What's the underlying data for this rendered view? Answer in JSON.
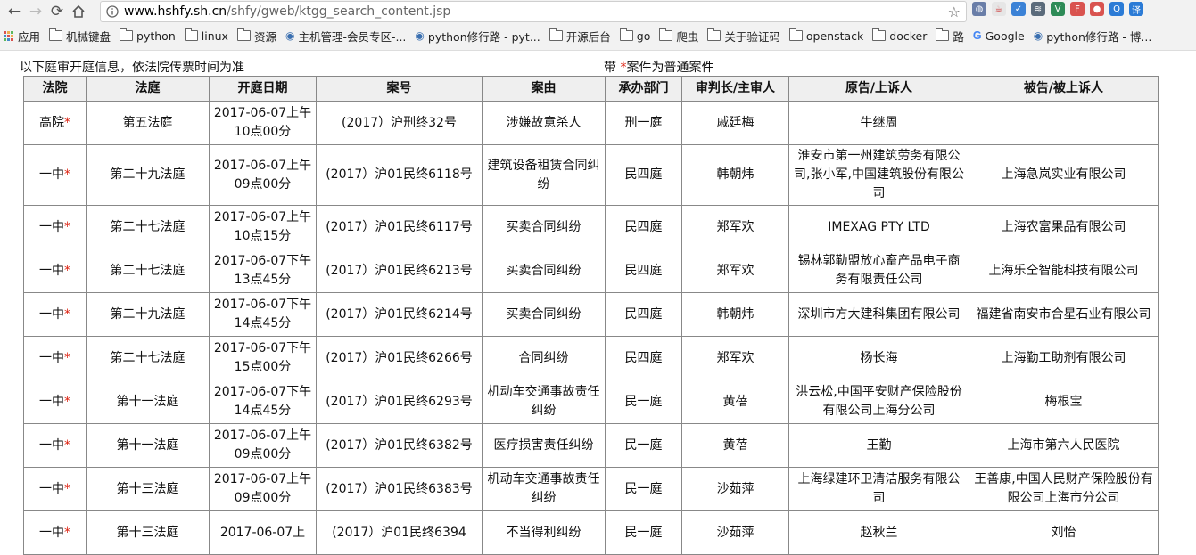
{
  "browser": {
    "url_host": "www.hshfy.sh.cn",
    "url_path": "/shfy/gweb/ktgg_search_content.jsp",
    "extensions": [
      {
        "icon": "extension-icon-1",
        "color": "#6a7ea8",
        "glyph": "◍"
      },
      {
        "icon": "java-icon",
        "color": "#e6e6e6",
        "glyph": "☕"
      },
      {
        "icon": "pocket-icon",
        "color": "#3b82d6",
        "glyph": "✓"
      },
      {
        "icon": "layers-icon",
        "color": "#5b6b7b",
        "glyph": "≋"
      },
      {
        "icon": "vim-icon",
        "color": "#2e8b57",
        "glyph": "V"
      },
      {
        "icon": "framework-icon",
        "color": "#d9534f",
        "glyph": "F"
      },
      {
        "icon": "record-icon",
        "color": "#d9534f",
        "glyph": "●"
      },
      {
        "icon": "search-ext-icon",
        "color": "#2b7bd6",
        "glyph": "Q"
      },
      {
        "icon": "translate-icon",
        "color": "#2b7bd6",
        "glyph": "译"
      }
    ],
    "bookmarks": [
      {
        "label": "应用",
        "icon": "apps-grid-icon"
      },
      {
        "label": "机械键盘",
        "icon": "folder-icon"
      },
      {
        "label": "python",
        "icon": "folder-icon"
      },
      {
        "label": "linux",
        "icon": "folder-icon"
      },
      {
        "label": "资源",
        "icon": "folder-icon"
      },
      {
        "label": "主机管理-会员专区-...",
        "icon": "site-icon"
      },
      {
        "label": "python修行路 - pyt...",
        "icon": "site-icon"
      },
      {
        "label": "开源后台",
        "icon": "folder-icon"
      },
      {
        "label": "go",
        "icon": "folder-icon"
      },
      {
        "label": "爬虫",
        "icon": "folder-icon"
      },
      {
        "label": "关于验证码",
        "icon": "folder-icon"
      },
      {
        "label": "openstack",
        "icon": "folder-icon"
      },
      {
        "label": "docker",
        "icon": "folder-icon"
      },
      {
        "label": "路",
        "icon": "folder-icon"
      },
      {
        "label": "Google",
        "icon": "google-icon"
      },
      {
        "label": "python修行路 - 博...",
        "icon": "site-icon"
      }
    ]
  },
  "page": {
    "notice_left": "以下庭审开庭信息，依法院传票时间为准",
    "notice_right_prefix": "带 ",
    "notice_right_star": "*",
    "notice_right_suffix": "案件为普通案件",
    "headers": [
      "法院",
      "法庭",
      "开庭日期",
      "案号",
      "案由",
      "承办部门",
      "审判长/主审人",
      "原告/上诉人",
      "被告/被上诉人"
    ],
    "rows": [
      {
        "court": "高院",
        "room": "第五法庭",
        "date": "2017-06-07上午10点00分",
        "case_no": "(2017）沪刑终32号",
        "cause": "涉嫌故意杀人",
        "dept": "刑一庭",
        "judge": "戚廷梅",
        "plaintiff": "牛继周",
        "defendant": ""
      },
      {
        "court": "一中",
        "room": "第二十九法庭",
        "date": "2017-06-07上午09点00分",
        "case_no": "(2017）沪01民终6118号",
        "cause": "建筑设备租赁合同纠纷",
        "dept": "民四庭",
        "judge": "韩朝炜",
        "plaintiff": "淮安市第一州建筑劳务有限公司,张小军,中国建筑股份有限公司",
        "defendant": "上海急岚实业有限公司"
      },
      {
        "court": "一中",
        "room": "第二十七法庭",
        "date": "2017-06-07上午10点15分",
        "case_no": "(2017）沪01民终6117号",
        "cause": "买卖合同纠纷",
        "dept": "民四庭",
        "judge": "郑军欢",
        "plaintiff": "IMEXAG PTY LTD",
        "defendant": "上海农富果品有限公司"
      },
      {
        "court": "一中",
        "room": "第二十七法庭",
        "date": "2017-06-07下午13点45分",
        "case_no": "(2017）沪01民终6213号",
        "cause": "买卖合同纠纷",
        "dept": "民四庭",
        "judge": "郑军欢",
        "plaintiff": "锡林郭勒盟放心畜产品电子商务有限责任公司",
        "defendant": "上海乐仝智能科技有限公司"
      },
      {
        "court": "一中",
        "room": "第二十九法庭",
        "date": "2017-06-07下午14点45分",
        "case_no": "(2017）沪01民终6214号",
        "cause": "买卖合同纠纷",
        "dept": "民四庭",
        "judge": "韩朝炜",
        "plaintiff": "深圳市方大建科集团有限公司",
        "defendant": "福建省南安市合星石业有限公司"
      },
      {
        "court": "一中",
        "room": "第二十七法庭",
        "date": "2017-06-07下午15点00分",
        "case_no": "(2017）沪01民终6266号",
        "cause": "合同纠纷",
        "dept": "民四庭",
        "judge": "郑军欢",
        "plaintiff": "杨长海",
        "defendant": "上海勤工助剂有限公司"
      },
      {
        "court": "一中",
        "room": "第十一法庭",
        "date": "2017-06-07下午14点45分",
        "case_no": "(2017）沪01民终6293号",
        "cause": "机动车交通事故责任纠纷",
        "dept": "民一庭",
        "judge": "黄蓓",
        "plaintiff": "洪云松,中国平安财产保险股份有限公司上海分公司",
        "defendant": "梅根宝"
      },
      {
        "court": "一中",
        "room": "第十一法庭",
        "date": "2017-06-07上午09点00分",
        "case_no": "(2017）沪01民终6382号",
        "cause": "医疗损害责任纠纷",
        "dept": "民一庭",
        "judge": "黄蓓",
        "plaintiff": "王勤",
        "defendant": "上海市第六人民医院"
      },
      {
        "court": "一中",
        "room": "第十三法庭",
        "date": "2017-06-07上午09点00分",
        "case_no": "(2017）沪01民终6383号",
        "cause": "机动车交通事故责任纠纷",
        "dept": "民一庭",
        "judge": "沙茹萍",
        "plaintiff": "上海绿建环卫清洁服务有限公司",
        "defendant": "王善康,中国人民财产保险股份有限公司上海市分公司"
      },
      {
        "court": "一中",
        "room": "第十三法庭",
        "date": "2017-06-07上",
        "case_no": "(2017）沪01民终6394",
        "cause": "不当得利纠纷",
        "dept": "民一庭",
        "judge": "沙茹萍",
        "plaintiff": "赵秋兰",
        "defendant": "刘怡"
      }
    ],
    "court_star": "*"
  }
}
